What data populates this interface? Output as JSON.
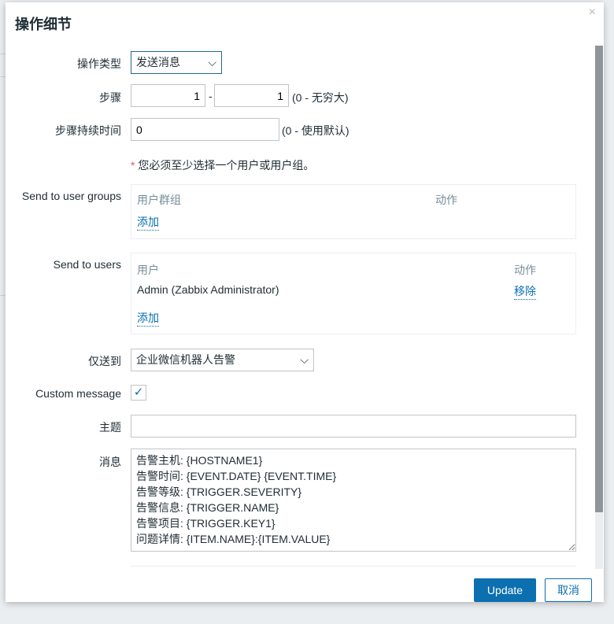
{
  "dialog": {
    "title": "操作细节",
    "close_icon": "×"
  },
  "operation_type": {
    "label": "操作类型",
    "value": "发送消息"
  },
  "steps": {
    "label": "步骤",
    "from": "1",
    "to": "1",
    "separator": "-",
    "hint": "(0 - 无穷大)"
  },
  "step_duration": {
    "label": "步骤持续时间",
    "value": "0",
    "hint": "(0 - 使用默认)"
  },
  "required_note": {
    "asterisk": "*",
    "text": "您必须至少选择一个用户或用户组。"
  },
  "user_groups": {
    "label": "Send to user groups",
    "col_group": "用户群组",
    "col_action": "动作",
    "add": "添加"
  },
  "users": {
    "label": "Send to users",
    "col_user": "用户",
    "col_action": "动作",
    "rows": [
      {
        "name": "Admin (Zabbix Administrator)",
        "action": "移除"
      }
    ],
    "add": "添加"
  },
  "send_only_to": {
    "label": "仅送到",
    "value": "企业微信机器人告警"
  },
  "custom_message": {
    "label": "Custom message",
    "checked": true
  },
  "subject": {
    "label": "主题",
    "value": ""
  },
  "message": {
    "label": "消息",
    "value": "告警主机: {HOSTNAME1}\n告警时间: {EVENT.DATE} {EVENT.TIME}\n告警等级: {TRIGGER.SEVERITY}\n告警信息: {TRIGGER.NAME}\n告警项目: {TRIGGER.KEY1}\n问题详情: {ITEM.NAME}:{ITEM.VALUE}"
  },
  "buttons": {
    "update": "Update",
    "cancel": "取消"
  },
  "colors": {
    "primary": "#0b6fb0",
    "border": "#c0c4c7"
  }
}
